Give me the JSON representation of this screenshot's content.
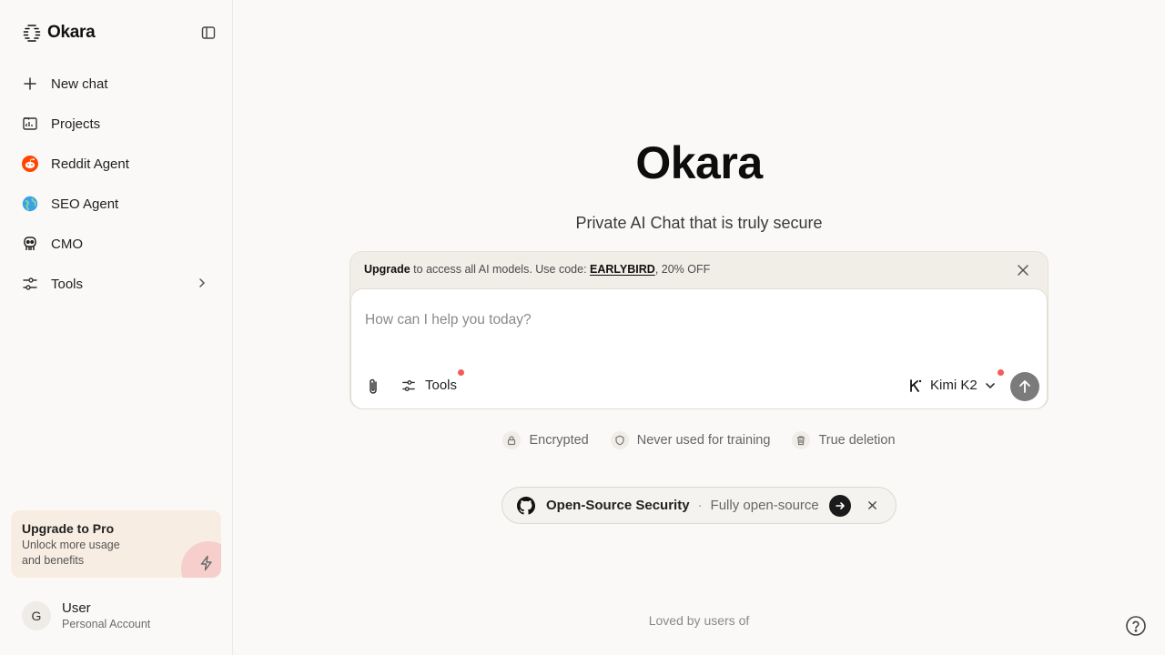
{
  "sidebar": {
    "brand": "Okara",
    "items": [
      {
        "label": "New chat",
        "icon": "plus-icon"
      },
      {
        "label": "Projects",
        "icon": "projects-icon"
      },
      {
        "label": "Reddit Agent",
        "icon": "reddit-icon"
      },
      {
        "label": "SEO Agent",
        "icon": "globe-icon"
      },
      {
        "label": "CMO",
        "icon": "robot-icon"
      },
      {
        "label": "Tools",
        "icon": "sliders-icon"
      }
    ],
    "upgrade": {
      "title": "Upgrade to Pro",
      "subtitle": "Unlock more usage and benefits"
    },
    "user": {
      "initial": "G",
      "name": "User",
      "account": "Personal Account"
    }
  },
  "main": {
    "title": "Okara",
    "subtitle": "Private AI Chat that is truly secure",
    "banner": {
      "strong": "Upgrade",
      "text": " to access all AI models. Use code: ",
      "code": "EARLYBIRD",
      "suffix": ", 20% OFF"
    },
    "composer": {
      "placeholder": "How can I help you today?",
      "tools_label": "Tools",
      "model_label": "Kimi K2"
    },
    "features": [
      "Encrypted",
      "Never used for training",
      "True deletion"
    ],
    "pill": {
      "title": "Open-Source Security",
      "separator": "·",
      "subtitle": "Fully open-source"
    },
    "loved": "Loved by users of"
  },
  "colors": {
    "background": "#faf9f7",
    "accent_red": "#f25c5c",
    "upgrade_card": "#f7ede2"
  }
}
